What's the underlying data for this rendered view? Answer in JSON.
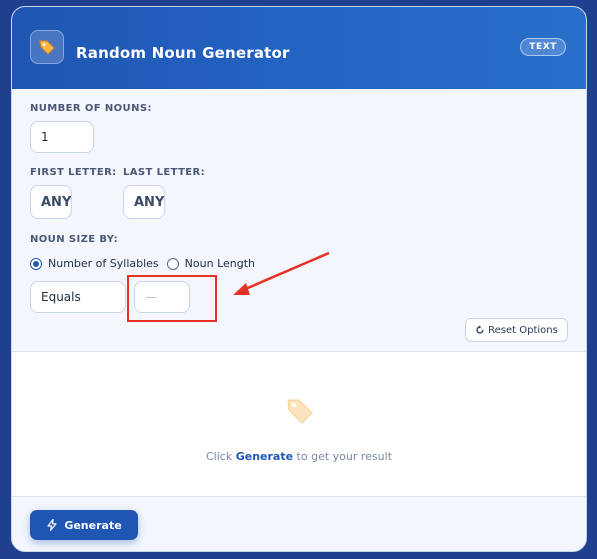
{
  "header": {
    "title": "Random Noun Generator",
    "badge": "TEXT",
    "icon": "tag-icon"
  },
  "form": {
    "number_label": "NUMBER OF NOUNS:",
    "number_value": "1",
    "first_letter_label": "FIRST LETTER:",
    "first_letter_value": "ANY",
    "last_letter_label": "LAST LETTER:",
    "last_letter_value": "ANY",
    "size_label": "NOUN SIZE BY:",
    "radio_options": [
      {
        "label": "Number of Syllables",
        "checked": true
      },
      {
        "label": "Noun Length",
        "checked": false
      }
    ],
    "comparison_value": "Equals",
    "size_value": "—",
    "reset_label": "Reset Options",
    "reset_icon": "refresh-icon"
  },
  "result": {
    "hint_prefix": "Click ",
    "hint_action": "Generate",
    "hint_suffix": " to get your result",
    "placeholder_icon": "tag-icon"
  },
  "footer": {
    "generate_label": "Generate",
    "generate_icon": "lightning-icon"
  },
  "colors": {
    "accent": "#1f56b3",
    "annotation": "#e53224",
    "background": "#1f3f8f"
  }
}
